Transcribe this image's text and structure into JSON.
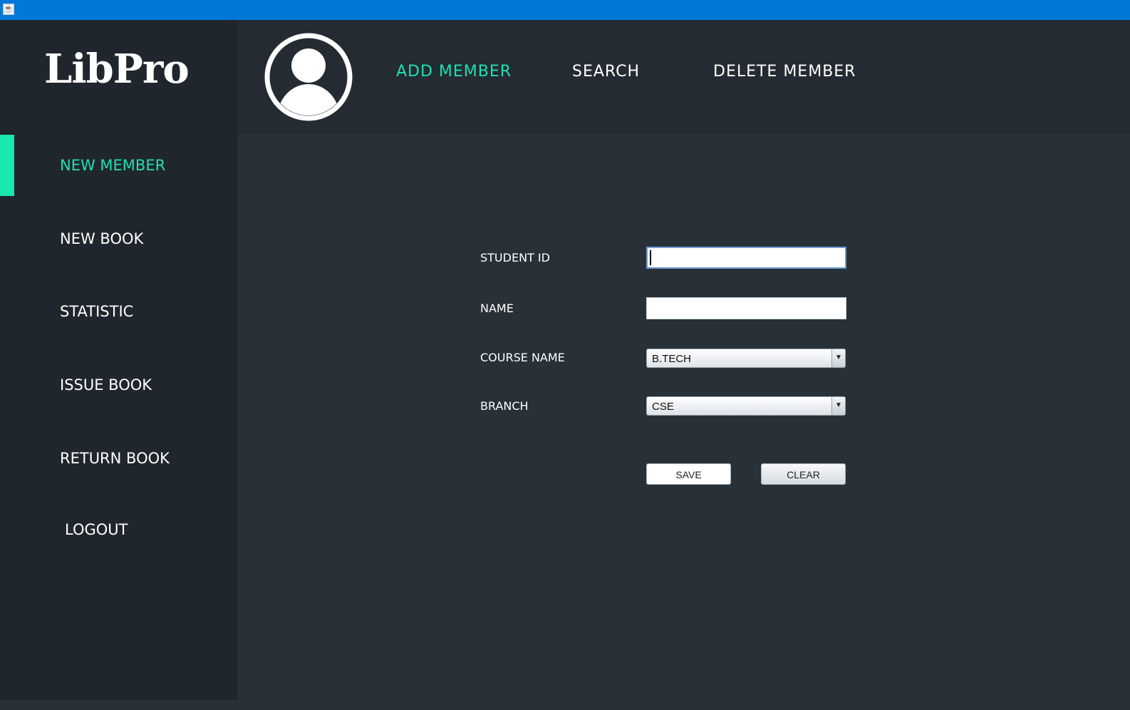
{
  "window": {
    "icon": "java-cup-icon",
    "title_bar_color": "#0078d7"
  },
  "app": {
    "logo_text": "LibPro",
    "accent_color": "#1ee0b0"
  },
  "sidebar": {
    "items": [
      {
        "label": "NEW MEMBER",
        "active": true
      },
      {
        "label": "NEW BOOK",
        "active": false
      },
      {
        "label": "STATISTIC",
        "active": false
      },
      {
        "label": "ISSUE BOOK",
        "active": false
      },
      {
        "label": "RETURN BOOK",
        "active": false
      },
      {
        "label": "LOGOUT",
        "active": false
      }
    ]
  },
  "header": {
    "avatar_icon": "user-profile-icon",
    "tabs": [
      {
        "label": "ADD MEMBER",
        "active": true
      },
      {
        "label": "SEARCH",
        "active": false
      },
      {
        "label": "DELETE MEMBER",
        "active": false
      }
    ]
  },
  "form": {
    "student_id": {
      "label": "STUDENT ID",
      "value": ""
    },
    "name": {
      "label": "NAME",
      "value": ""
    },
    "course": {
      "label": "COURSE NAME",
      "selected": "B.TECH"
    },
    "branch": {
      "label": "BRANCH",
      "selected": "CSE"
    },
    "save_label": "SAVE",
    "clear_label": "CLEAR"
  }
}
